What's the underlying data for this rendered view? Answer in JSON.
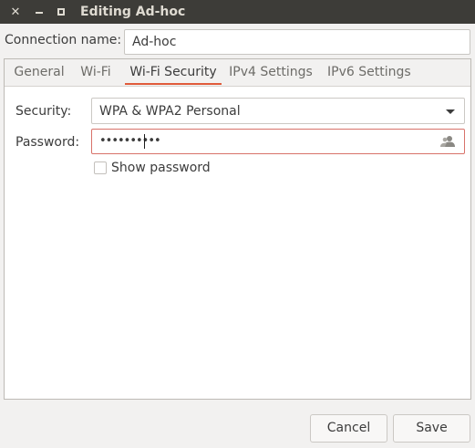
{
  "window": {
    "title": "Editing Ad-hoc",
    "close_glyph": "✕"
  },
  "connection": {
    "label": "Connection name:",
    "value": "Ad-hoc"
  },
  "tabs": [
    {
      "label": "General"
    },
    {
      "label": "Wi-Fi"
    },
    {
      "label": "Wi-Fi Security",
      "active": true
    },
    {
      "label": "IPv4 Settings"
    },
    {
      "label": "IPv6 Settings"
    }
  ],
  "security": {
    "label": "Security:",
    "selected": "WPA & WPA2 Personal"
  },
  "password": {
    "label": "Password:",
    "masked_value": "••••••••••",
    "icon": "user-icon"
  },
  "show_password": {
    "label": "Show password",
    "checked": false
  },
  "buttons": {
    "cancel": "Cancel",
    "save": "Save"
  },
  "colors": {
    "titlebar": "#3d3c38",
    "accent": "#e05b3a",
    "error_border": "#d8726a"
  }
}
